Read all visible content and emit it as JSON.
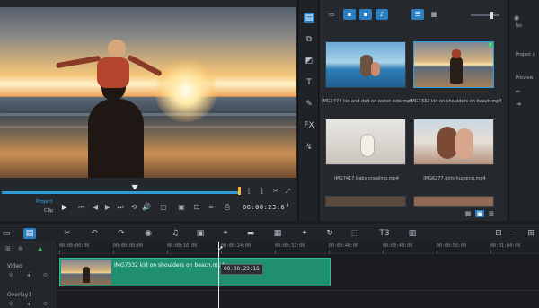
{
  "preview": {
    "project_label": "Project",
    "clip_label": "Clip",
    "timecode": "00:00:23:6"
  },
  "library": {
    "items": [
      {
        "caption": "IMG5474 kid and dad on water side.mp4",
        "selected": false
      },
      {
        "caption": "IMG7332 kid on shoulders on beach.mp4",
        "selected": true
      },
      {
        "caption": "IMG7417 baby crawling.mp4",
        "selected": false
      },
      {
        "caption": "IMG6277 girls hugging.mp4",
        "selected": false
      }
    ]
  },
  "options": {
    "items": [
      "No",
      "Project d",
      "Preview"
    ]
  },
  "timeline": {
    "ruler": [
      "00:00:00:00",
      "00:00:08:00",
      "00:00:16:00",
      "00:00:24:00",
      "00:00:32:00",
      "00:00:40:00",
      "00:00:48:00",
      "00:00:56:00",
      "00:01:04:00"
    ],
    "tracks": [
      {
        "name": "Video"
      },
      {
        "name": "Overlay1"
      }
    ],
    "clip_label": "IMG7332 kid on shoulders on beach.mp4",
    "tooltip": "00:00:23:16"
  },
  "colors": {
    "accent": "#2b7fc0",
    "clip": "#1f8f6f",
    "scrub": "#2d9cd6"
  }
}
